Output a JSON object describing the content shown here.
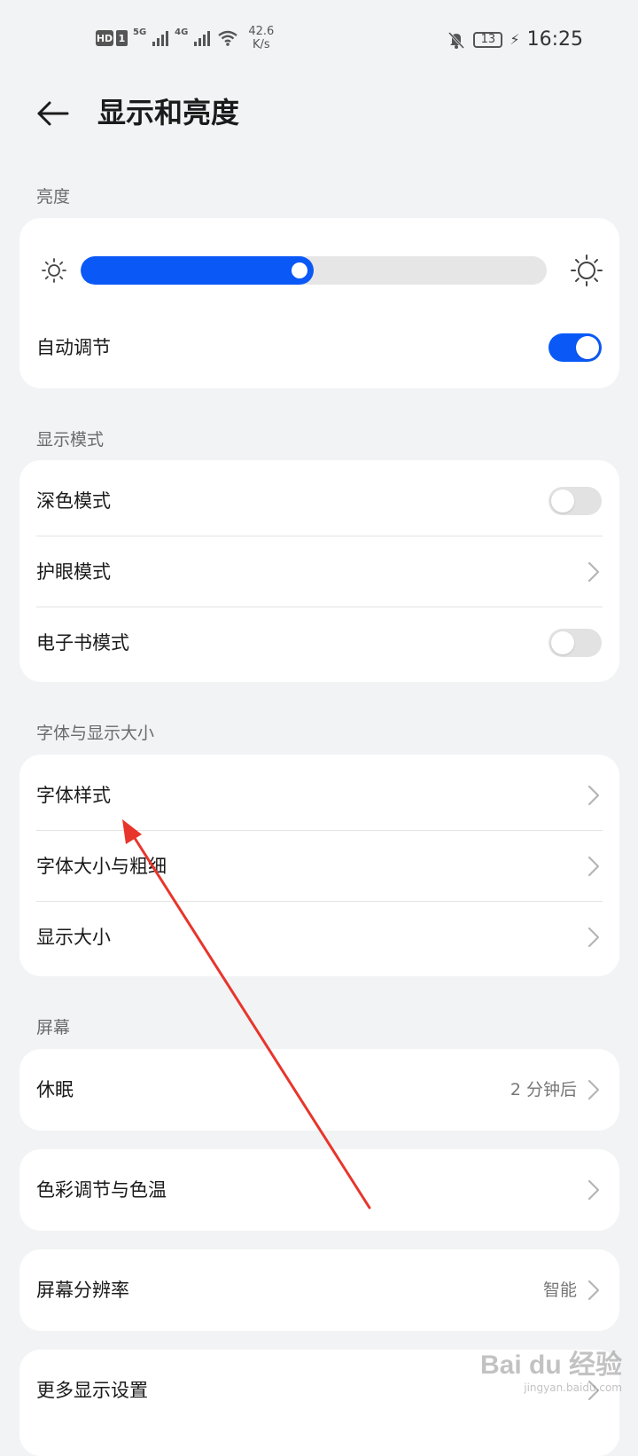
{
  "status_bar": {
    "hd": "HD",
    "sim": "1",
    "net1": "5G",
    "net2": "4G",
    "speed_value": "42.6",
    "speed_unit": "K/s",
    "battery": "13",
    "time": "16:25"
  },
  "header": {
    "title": "显示和亮度"
  },
  "brightness": {
    "section_label": "亮度",
    "level": 0.5,
    "auto_label": "自动调节",
    "auto_on": true
  },
  "display_mode": {
    "section_label": "显示模式",
    "items": [
      {
        "label": "深色模式",
        "control": "toggle",
        "on": false
      },
      {
        "label": "护眼模式",
        "control": "chevron"
      },
      {
        "label": "电子书模式",
        "control": "toggle",
        "on": false
      }
    ]
  },
  "font": {
    "section_label": "字体与显示大小",
    "items": [
      {
        "label": "字体样式"
      },
      {
        "label": "字体大小与粗细"
      },
      {
        "label": "显示大小"
      }
    ]
  },
  "screen": {
    "section_label": "屏幕",
    "sleep_label": "休眠",
    "sleep_value": "2 分钟后",
    "color_label": "色彩调节与色温",
    "resolution_label": "屏幕分辨率",
    "resolution_value": "智能",
    "more_label": "更多显示设置"
  },
  "watermark": {
    "logo": "Bai du 经验",
    "url": "jingyan.baidu.com"
  },
  "colors": {
    "accent": "#0a59f7",
    "background": "#f1f3f5",
    "annotation": "#e8352b"
  }
}
